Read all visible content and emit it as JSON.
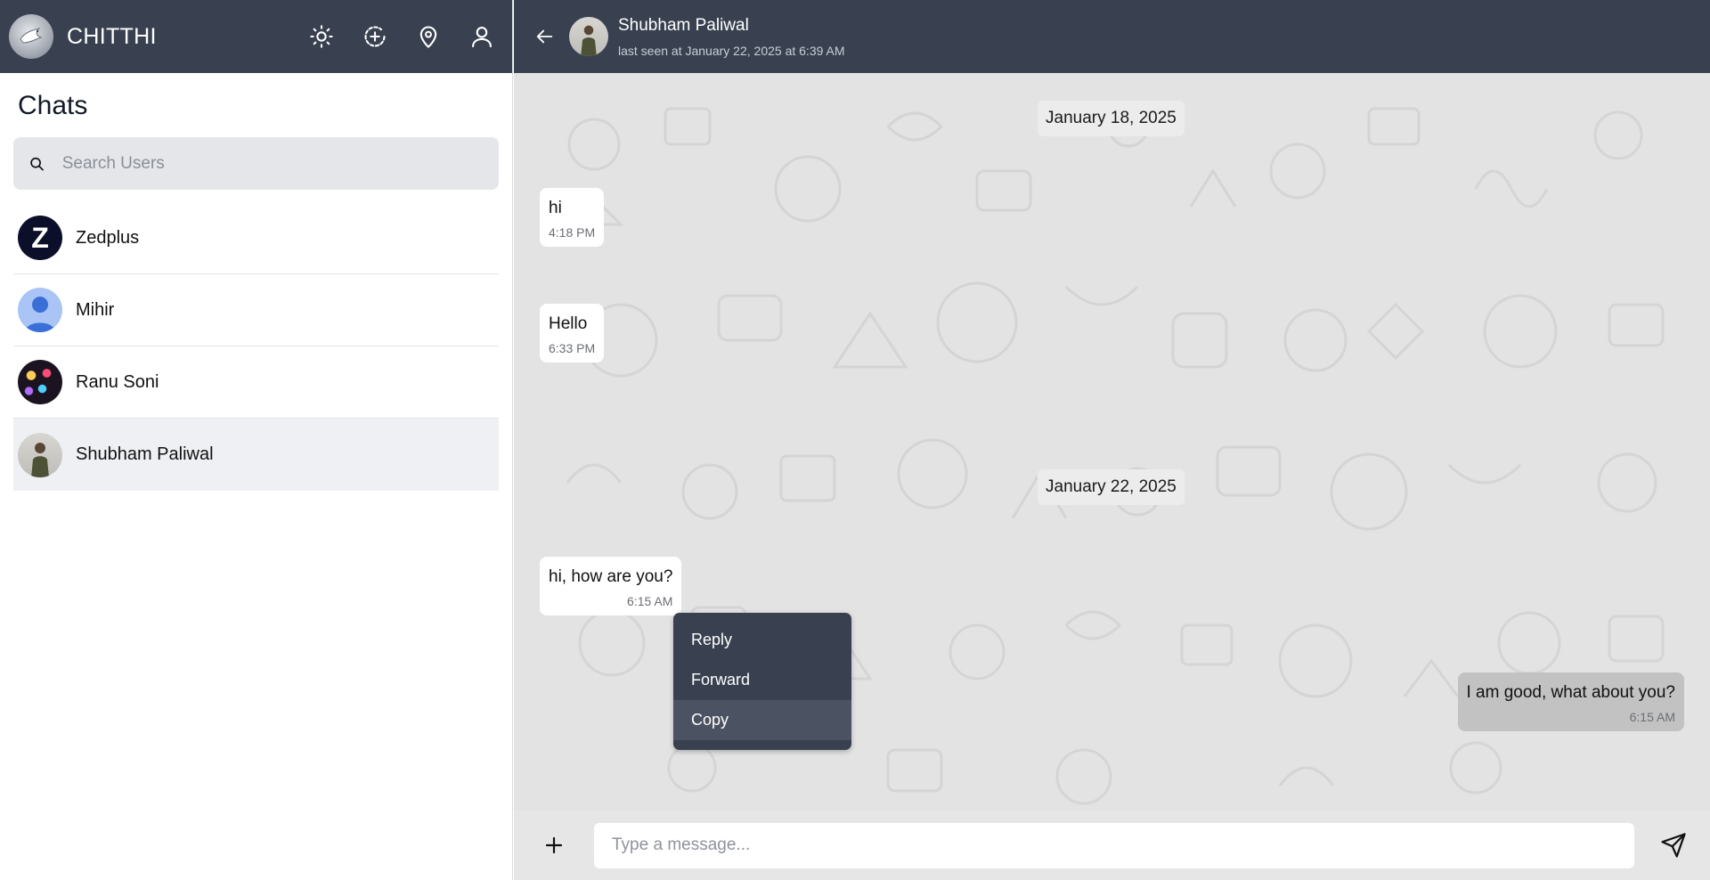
{
  "app": {
    "title": "CHITTHI"
  },
  "header_icons": [
    {
      "name": "theme-toggle",
      "icon": "sun-icon"
    },
    {
      "name": "new-status",
      "icon": "add-circle-icon"
    },
    {
      "name": "location",
      "icon": "map-pin-icon"
    },
    {
      "name": "profile",
      "icon": "user-icon"
    }
  ],
  "sidebar": {
    "title": "Chats",
    "search_placeholder": "Search Users",
    "chats": [
      {
        "name": "Zedplus",
        "avatar_letter": "Z"
      },
      {
        "name": "Mihir"
      },
      {
        "name": "Ranu Soni"
      },
      {
        "name": "Shubham Paliwal",
        "active": true
      }
    ]
  },
  "conversation": {
    "peer_name": "Shubham Paliwal",
    "last_seen": "last seen at January 22, 2025 at 6:39 AM",
    "dates": [
      "January 18, 2025",
      "January 22, 2025"
    ],
    "messages": [
      {
        "text": "hi",
        "time": "4:18 PM",
        "direction": "in"
      },
      {
        "text": "Hello",
        "time": "6:33 PM",
        "direction": "in"
      },
      {
        "text": "hi, how are you?",
        "time": "6:15 AM",
        "direction": "in"
      },
      {
        "text": "I am good, what about you?",
        "time": "6:15 AM",
        "direction": "out"
      }
    ]
  },
  "context_menu": {
    "items": [
      "Reply",
      "Forward",
      "Copy"
    ],
    "highlighted": "Copy"
  },
  "composer": {
    "placeholder": "Type a message..."
  },
  "colors": {
    "header_bg": "#394150",
    "chat_bg": "#e3e3e3",
    "incoming_bubble": "#ffffff",
    "outgoing_bubble": "#c2c2c3",
    "search_bg": "#e5e6ea"
  }
}
